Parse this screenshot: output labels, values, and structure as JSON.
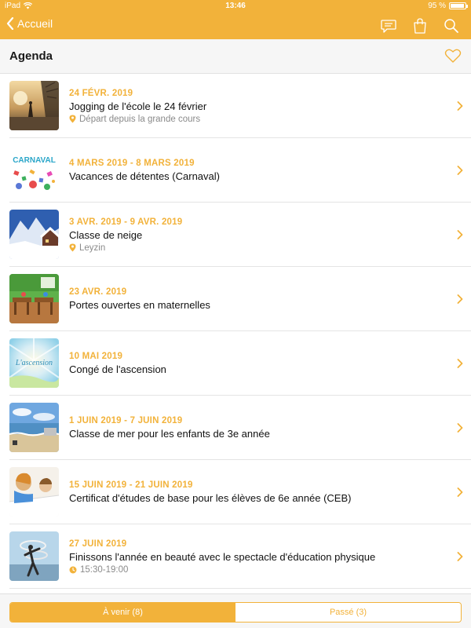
{
  "status": {
    "device": "iPad",
    "time": "13:46",
    "battery": "95 %",
    "battery_level": 0.95
  },
  "nav": {
    "back_label": "Accueil",
    "icons": [
      "chat-icon",
      "bag-icon",
      "search-icon"
    ]
  },
  "page": {
    "title": "Agenda"
  },
  "colors": {
    "accent": "#f2b23a",
    "background": "#ffffff",
    "text": "#111111",
    "muted": "#8a8a8a"
  },
  "events": [
    {
      "date": "24 FÉVR. 2019",
      "title": "Jogging de l'école le 24 février",
      "location": "Départ depuis la grande cours",
      "time": ""
    },
    {
      "date": "4 MARS 2019 - 8 MARS 2019",
      "title": "Vacances de détentes (Carnaval)",
      "location": "",
      "time": ""
    },
    {
      "date": "3 AVR. 2019 - 9 AVR. 2019",
      "title": "Classe de neige",
      "location": "Leyzin",
      "time": ""
    },
    {
      "date": "23 AVR. 2019",
      "title": "Portes ouvertes en maternelles",
      "location": "",
      "time": ""
    },
    {
      "date": "10 MAI 2019",
      "title": "Congé de l'ascension",
      "location": "",
      "time": ""
    },
    {
      "date": "1 JUIN 2019 - 7 JUIN 2019",
      "title": "Classe de mer pour les enfants de 3e année",
      "location": "",
      "time": ""
    },
    {
      "date": "15 JUIN 2019 - 21 JUIN 2019",
      "title": "Certificat d'études de base pour les élèves de 6e année (CEB)",
      "location": "",
      "time": ""
    },
    {
      "date": "27 JUIN 2019",
      "title": "Finissons l'année en beauté avec le spectacle d'éducation physique",
      "location": "",
      "time": "15:30-19:00"
    }
  ],
  "thumbnails": {
    "carnaval_text": "CARNAVAL",
    "ascension_text": "L'ascension"
  },
  "segments": {
    "upcoming": "À venir (8)",
    "past": "Passé (3)",
    "selected": "upcoming"
  }
}
